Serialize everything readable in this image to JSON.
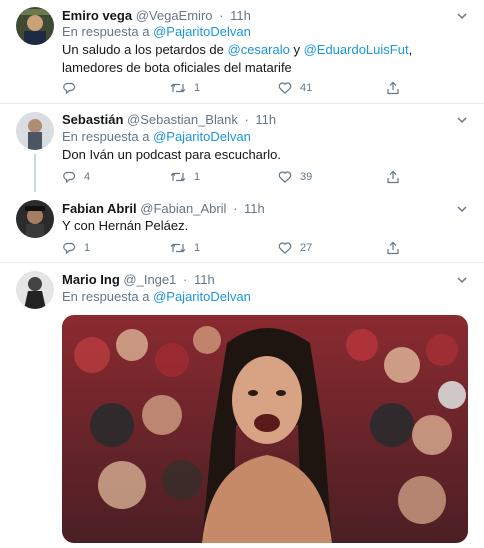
{
  "tweets": [
    {
      "name": "Emiro vega",
      "handle": "@VegaEmiro",
      "time": "11h",
      "reply_prefix": "En respuesta a",
      "reply_to": "@PajaritoDelvan",
      "text_parts": [
        "Un saludo a los petardos de ",
        "@cesaralo",
        " y ",
        "@EduardoLuisFut",
        ", lamedores de bota oficiales del matarife"
      ],
      "replies": "",
      "retweets": "1",
      "likes": "41"
    },
    {
      "name": "Sebastián",
      "handle": "@Sebastian_Blank",
      "time": "11h",
      "reply_prefix": "En respuesta a",
      "reply_to": "@PajaritoDelvan",
      "text": "Don Iván un podcast para escucharlo.",
      "replies": "4",
      "retweets": "1",
      "likes": "39"
    },
    {
      "name": "Fabian Abril",
      "handle": "@Fabian_Abril",
      "time": "11h",
      "text": "Y con Hernán Peláez.",
      "replies": "1",
      "retweets": "1",
      "likes": "27"
    },
    {
      "name": "Mario Ing",
      "handle": "@_Inge1",
      "time": "11h",
      "reply_prefix": "En respuesta a",
      "reply_to": "@PajaritoDelvan"
    }
  ],
  "separator": "·",
  "colors": {
    "link": "#1b95e0",
    "muted": "#657786",
    "text": "#14171a",
    "divider": "#e6ecf0",
    "thread_line": "#ccd6dd"
  },
  "icons": {
    "reply": "reply-icon",
    "retweet": "retweet-icon",
    "like": "heart-icon",
    "share": "share-icon",
    "menu": "chevron-down-icon"
  }
}
